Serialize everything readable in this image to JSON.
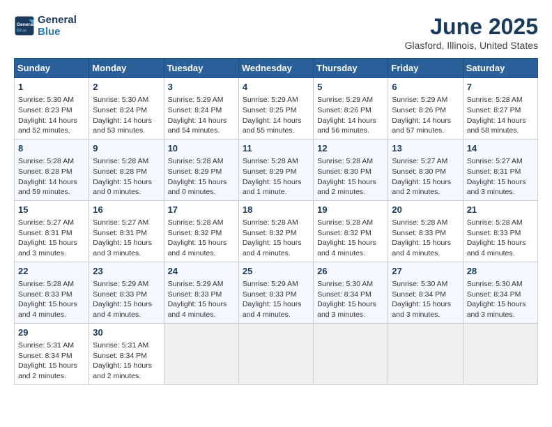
{
  "header": {
    "logo_line1": "General",
    "logo_line2": "Blue",
    "month": "June 2025",
    "location": "Glasford, Illinois, United States"
  },
  "weekdays": [
    "Sunday",
    "Monday",
    "Tuesday",
    "Wednesday",
    "Thursday",
    "Friday",
    "Saturday"
  ],
  "weeks": [
    [
      {
        "day": "1",
        "text": "Sunrise: 5:30 AM\nSunset: 8:23 PM\nDaylight: 14 hours\nand 52 minutes."
      },
      {
        "day": "2",
        "text": "Sunrise: 5:30 AM\nSunset: 8:24 PM\nDaylight: 14 hours\nand 53 minutes."
      },
      {
        "day": "3",
        "text": "Sunrise: 5:29 AM\nSunset: 8:24 PM\nDaylight: 14 hours\nand 54 minutes."
      },
      {
        "day": "4",
        "text": "Sunrise: 5:29 AM\nSunset: 8:25 PM\nDaylight: 14 hours\nand 55 minutes."
      },
      {
        "day": "5",
        "text": "Sunrise: 5:29 AM\nSunset: 8:26 PM\nDaylight: 14 hours\nand 56 minutes."
      },
      {
        "day": "6",
        "text": "Sunrise: 5:29 AM\nSunset: 8:26 PM\nDaylight: 14 hours\nand 57 minutes."
      },
      {
        "day": "7",
        "text": "Sunrise: 5:28 AM\nSunset: 8:27 PM\nDaylight: 14 hours\nand 58 minutes."
      }
    ],
    [
      {
        "day": "8",
        "text": "Sunrise: 5:28 AM\nSunset: 8:28 PM\nDaylight: 14 hours\nand 59 minutes."
      },
      {
        "day": "9",
        "text": "Sunrise: 5:28 AM\nSunset: 8:28 PM\nDaylight: 15 hours\nand 0 minutes."
      },
      {
        "day": "10",
        "text": "Sunrise: 5:28 AM\nSunset: 8:29 PM\nDaylight: 15 hours\nand 0 minutes."
      },
      {
        "day": "11",
        "text": "Sunrise: 5:28 AM\nSunset: 8:29 PM\nDaylight: 15 hours\nand 1 minute."
      },
      {
        "day": "12",
        "text": "Sunrise: 5:28 AM\nSunset: 8:30 PM\nDaylight: 15 hours\nand 2 minutes."
      },
      {
        "day": "13",
        "text": "Sunrise: 5:27 AM\nSunset: 8:30 PM\nDaylight: 15 hours\nand 2 minutes."
      },
      {
        "day": "14",
        "text": "Sunrise: 5:27 AM\nSunset: 8:31 PM\nDaylight: 15 hours\nand 3 minutes."
      }
    ],
    [
      {
        "day": "15",
        "text": "Sunrise: 5:27 AM\nSunset: 8:31 PM\nDaylight: 15 hours\nand 3 minutes."
      },
      {
        "day": "16",
        "text": "Sunrise: 5:27 AM\nSunset: 8:31 PM\nDaylight: 15 hours\nand 3 minutes."
      },
      {
        "day": "17",
        "text": "Sunrise: 5:28 AM\nSunset: 8:32 PM\nDaylight: 15 hours\nand 4 minutes."
      },
      {
        "day": "18",
        "text": "Sunrise: 5:28 AM\nSunset: 8:32 PM\nDaylight: 15 hours\nand 4 minutes."
      },
      {
        "day": "19",
        "text": "Sunrise: 5:28 AM\nSunset: 8:32 PM\nDaylight: 15 hours\nand 4 minutes."
      },
      {
        "day": "20",
        "text": "Sunrise: 5:28 AM\nSunset: 8:33 PM\nDaylight: 15 hours\nand 4 minutes."
      },
      {
        "day": "21",
        "text": "Sunrise: 5:28 AM\nSunset: 8:33 PM\nDaylight: 15 hours\nand 4 minutes."
      }
    ],
    [
      {
        "day": "22",
        "text": "Sunrise: 5:28 AM\nSunset: 8:33 PM\nDaylight: 15 hours\nand 4 minutes."
      },
      {
        "day": "23",
        "text": "Sunrise: 5:29 AM\nSunset: 8:33 PM\nDaylight: 15 hours\nand 4 minutes."
      },
      {
        "day": "24",
        "text": "Sunrise: 5:29 AM\nSunset: 8:33 PM\nDaylight: 15 hours\nand 4 minutes."
      },
      {
        "day": "25",
        "text": "Sunrise: 5:29 AM\nSunset: 8:33 PM\nDaylight: 15 hours\nand 4 minutes."
      },
      {
        "day": "26",
        "text": "Sunrise: 5:30 AM\nSunset: 8:34 PM\nDaylight: 15 hours\nand 3 minutes."
      },
      {
        "day": "27",
        "text": "Sunrise: 5:30 AM\nSunset: 8:34 PM\nDaylight: 15 hours\nand 3 minutes."
      },
      {
        "day": "28",
        "text": "Sunrise: 5:30 AM\nSunset: 8:34 PM\nDaylight: 15 hours\nand 3 minutes."
      }
    ],
    [
      {
        "day": "29",
        "text": "Sunrise: 5:31 AM\nSunset: 8:34 PM\nDaylight: 15 hours\nand 2 minutes."
      },
      {
        "day": "30",
        "text": "Sunrise: 5:31 AM\nSunset: 8:34 PM\nDaylight: 15 hours\nand 2 minutes."
      },
      null,
      null,
      null,
      null,
      null
    ]
  ]
}
